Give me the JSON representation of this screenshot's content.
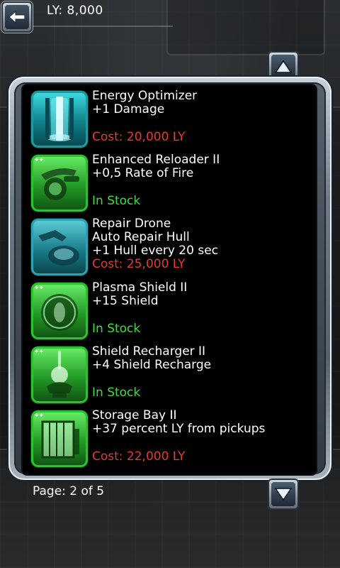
{
  "header": {
    "ly_label": "LY: 8,000"
  },
  "footer": {
    "page_label": "Page: 2 of 5"
  },
  "items": [
    {
      "name": "Energy Optimizer",
      "lines": [
        "+1 Damage"
      ],
      "status": "Cost: 20,000 LY",
      "status_type": "cost",
      "icon": "energy-optimizer-icon"
    },
    {
      "name": "Enhanced Reloader II",
      "lines": [
        "+0,5 Rate of Fire"
      ],
      "status": "In Stock",
      "status_type": "stock",
      "icon": "reloader-icon"
    },
    {
      "name": "Repair Drone",
      "lines": [
        "Auto Repair Hull",
        "+1 Hull every 20 sec"
      ],
      "status": "Cost: 25,000 LY",
      "status_type": "cost",
      "icon": "repair-drone-icon"
    },
    {
      "name": "Plasma Shield II",
      "lines": [
        "+15 Shield"
      ],
      "status": "In Stock",
      "status_type": "stock",
      "icon": "plasma-shield-icon"
    },
    {
      "name": "Shield Recharger II",
      "lines": [
        "+4 Shield Recharge"
      ],
      "status": "In Stock",
      "status_type": "stock",
      "icon": "shield-recharger-icon"
    },
    {
      "name": "Storage Bay II",
      "lines": [
        "+37 percent LY from pickups"
      ],
      "status": "Cost: 22,000 LY",
      "status_type": "cost",
      "icon": "storage-bay-icon"
    }
  ],
  "colors": {
    "cost": "#e23a34",
    "stock": "#39e03a"
  }
}
